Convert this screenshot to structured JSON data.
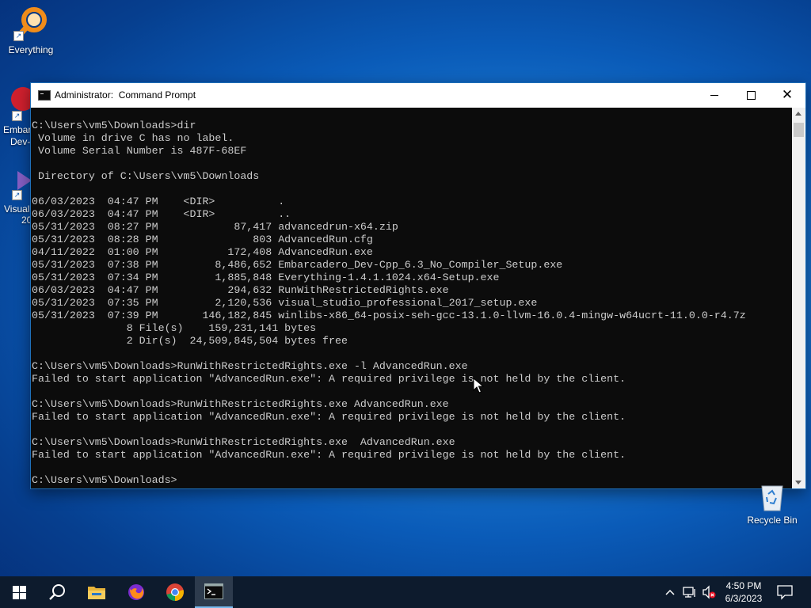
{
  "desktop": {
    "icons": [
      {
        "label": "Everything"
      }
    ],
    "partial_labels": [
      "Embar",
      "Dev-",
      "Visual",
      "20"
    ],
    "recycle_bin": {
      "label": "Recycle Bin"
    }
  },
  "window": {
    "title": "Administrator:  Command Prompt",
    "controls": {
      "minimize": "—",
      "maximize": "☐",
      "close": "✕"
    }
  },
  "console": {
    "lines": [
      "C:\\Users\\vm5\\Downloads>dir",
      " Volume in drive C has no label.",
      " Volume Serial Number is 487F-68EF",
      "",
      " Directory of C:\\Users\\vm5\\Downloads",
      "",
      "06/03/2023  04:47 PM    <DIR>          .",
      "06/03/2023  04:47 PM    <DIR>          ..",
      "05/31/2023  08:27 PM            87,417 advancedrun-x64.zip",
      "05/31/2023  08:28 PM               803 AdvancedRun.cfg",
      "04/11/2022  01:00 PM           172,408 AdvancedRun.exe",
      "05/31/2023  07:38 PM         8,486,652 Embarcadero_Dev-Cpp_6.3_No_Compiler_Setup.exe",
      "05/31/2023  07:34 PM         1,885,848 Everything-1.4.1.1024.x64-Setup.exe",
      "06/03/2023  04:47 PM           294,632 RunWithRestrictedRights.exe",
      "05/31/2023  07:35 PM         2,120,536 visual_studio_professional_2017_setup.exe",
      "05/31/2023  07:39 PM       146,182,845 winlibs-x86_64-posix-seh-gcc-13.1.0-llvm-16.0.4-mingw-w64ucrt-11.0.0-r4.7z",
      "               8 File(s)    159,231,141 bytes",
      "               2 Dir(s)  24,509,845,504 bytes free",
      "",
      "C:\\Users\\vm5\\Downloads>RunWithRestrictedRights.exe -l AdvancedRun.exe",
      "Failed to start application \"AdvancedRun.exe\": A required privilege is not held by the client.",
      "",
      "C:\\Users\\vm5\\Downloads>RunWithRestrictedRights.exe AdvancedRun.exe",
      "Failed to start application \"AdvancedRun.exe\": A required privilege is not held by the client.",
      "",
      "C:\\Users\\vm5\\Downloads>RunWithRestrictedRights.exe  AdvancedRun.exe",
      "Failed to start application \"AdvancedRun.exe\": A required privilege is not held by the client.",
      "",
      "C:\\Users\\vm5\\Downloads>"
    ]
  },
  "taskbar": {
    "items": [
      "start-icon",
      "search-icon",
      "file-explorer-icon",
      "firefox-icon",
      "chrome-icon",
      "command-prompt-icon"
    ],
    "tray": {
      "icons": [
        "chevron-up-icon",
        "network-icon",
        "volume-muted-icon"
      ],
      "time": "4:50 PM",
      "date": "6/3/2023"
    }
  },
  "colors": {
    "console_bg": "#0c0c0c",
    "console_text": "#cccccc",
    "taskbar_bg": "#0d1b2d",
    "desktop_blue": "#1e7fd6"
  }
}
